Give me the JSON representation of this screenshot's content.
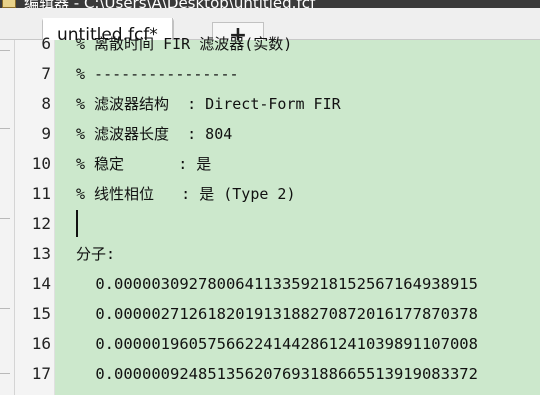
{
  "window": {
    "title": "编辑器 - C:\\Users\\A\\Desktop\\untitled.fcf"
  },
  "tabs": {
    "active_label": "untitled.fcf*",
    "add_label": "+"
  },
  "editor": {
    "lines": [
      {
        "num": "6",
        "text": "% 离散时间 FIR 滤波器(实数)"
      },
      {
        "num": "7",
        "text": "% ----------------"
      },
      {
        "num": "8",
        "text": "% 滤波器结构  : Direct-Form FIR"
      },
      {
        "num": "9",
        "text": "% 滤波器长度  : 804"
      },
      {
        "num": "10",
        "text": "% 稳定      : 是"
      },
      {
        "num": "11",
        "text": "% 线性相位   : 是 (Type 2)"
      },
      {
        "num": "12",
        "text": ""
      },
      {
        "num": "13",
        "text": "分子:"
      },
      {
        "num": "14",
        "text": " 0.000003092780064113359218152567164938915"
      },
      {
        "num": "15",
        "text": " 0.000002712618201913188270872016177870378"
      },
      {
        "num": "16",
        "text": " 0.000001960575662241442861241039891107008"
      },
      {
        "num": "17",
        "text": " 0.000000924851356207693188665513919083372"
      }
    ]
  }
}
